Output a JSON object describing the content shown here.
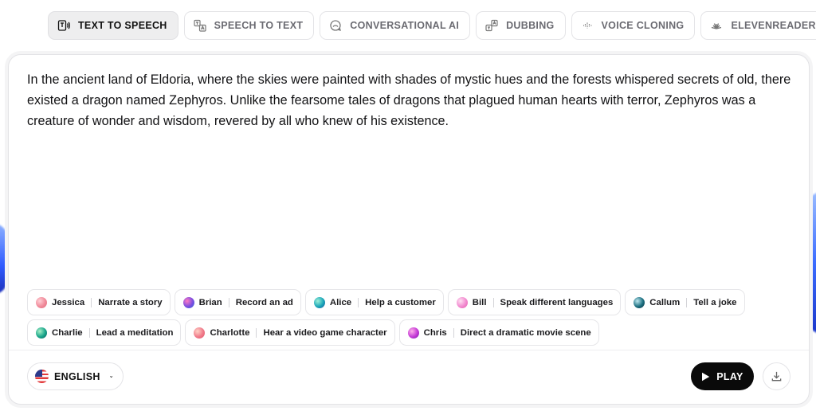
{
  "tabs": [
    {
      "label": "TEXT TO SPEECH",
      "icon": "text-to-speech-icon",
      "active": true
    },
    {
      "label": "SPEECH TO TEXT",
      "icon": "speech-to-text-icon",
      "active": false
    },
    {
      "label": "CONVERSATIONAL AI",
      "icon": "conversational-ai-icon",
      "active": false
    },
    {
      "label": "DUBBING",
      "icon": "dubbing-icon",
      "active": false
    },
    {
      "label": "VOICE CLONING",
      "icon": "voice-cloning-icon",
      "active": false
    },
    {
      "label": "ELEVENREADER",
      "icon": "elevenreader-icon",
      "active": false
    }
  ],
  "editor": {
    "text": "In the ancient land of Eldoria, where the skies were painted with shades of mystic hues and the forests whispered secrets of old, there existed a dragon named Zephyros. Unlike the fearsome tales of dragons that plagued human hearts with terror, Zephyros was a creature of wonder and wisdom, revered by all who knew of his existence."
  },
  "voices": [
    {
      "name": "Jessica",
      "prompt": "Narrate a story",
      "color": "#f08a9a"
    },
    {
      "name": "Brian",
      "prompt": "Record an ad",
      "color": "#7b4de0"
    },
    {
      "name": "Alice",
      "prompt": "Help a customer",
      "color": "#1aa6b8"
    },
    {
      "name": "Bill",
      "prompt": "Speak different languages",
      "color": "#f28ad0"
    },
    {
      "name": "Callum",
      "prompt": "Tell a joke",
      "color": "#1b6f80"
    },
    {
      "name": "Charlie",
      "prompt": "Lead a meditation",
      "color": "#18a58a"
    },
    {
      "name": "Charlotte",
      "prompt": "Hear a video game character",
      "color": "#f07a8a"
    },
    {
      "name": "Chris",
      "prompt": "Direct a dramatic movie scene",
      "color": "#c43ad6"
    }
  ],
  "footer": {
    "language": "ENGLISH",
    "language_flag": "us-flag-icon",
    "play_label": "PLAY",
    "download_icon": "download-icon"
  }
}
